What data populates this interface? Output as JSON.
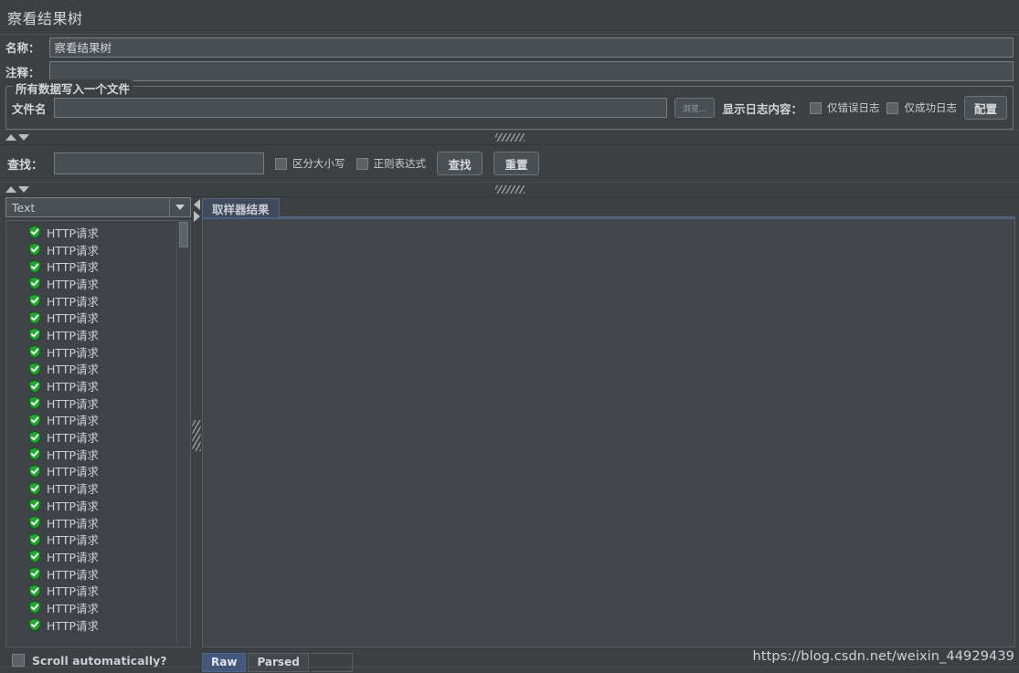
{
  "window": {
    "title": "察看结果树"
  },
  "name_row": {
    "label": "名称：",
    "value": "察看结果树"
  },
  "comment_row": {
    "label": "注释：",
    "value": "",
    "placeholder": ""
  },
  "file_group": {
    "title": "所有数据写入一个文件",
    "filename_label": "文件名",
    "filename_value": "",
    "browse_label": "浏览...",
    "log_display_label": "显示日志内容：",
    "errors_only_label": "仅错误日志",
    "errors_only_checked": false,
    "successes_only_label": "仅成功日志",
    "successes_only_checked": false,
    "configure_label": "配置"
  },
  "search_row": {
    "label": "查找：",
    "value": "",
    "case_sensitive_label": "区分大小写",
    "case_sensitive_checked": false,
    "regexp_label": "正则表达式",
    "regexp_checked": false,
    "search_button_label": "查找",
    "reset_button_label": "重置"
  },
  "left_pane": {
    "renderer_selected": "Text",
    "tree_items": [
      {
        "label": "HTTP请求",
        "status": "success"
      },
      {
        "label": "HTTP请求",
        "status": "success"
      },
      {
        "label": "HTTP请求",
        "status": "success"
      },
      {
        "label": "HTTP请求",
        "status": "success"
      },
      {
        "label": "HTTP请求",
        "status": "success"
      },
      {
        "label": "HTTP请求",
        "status": "success"
      },
      {
        "label": "HTTP请求",
        "status": "success"
      },
      {
        "label": "HTTP请求",
        "status": "success"
      },
      {
        "label": "HTTP请求",
        "status": "success"
      },
      {
        "label": "HTTP请求",
        "status": "success"
      },
      {
        "label": "HTTP请求",
        "status": "success"
      },
      {
        "label": "HTTP请求",
        "status": "success"
      },
      {
        "label": "HTTP请求",
        "status": "success"
      },
      {
        "label": "HTTP请求",
        "status": "success"
      },
      {
        "label": "HTTP请求",
        "status": "success"
      },
      {
        "label": "HTTP请求",
        "status": "success"
      },
      {
        "label": "HTTP请求",
        "status": "success"
      },
      {
        "label": "HTTP请求",
        "status": "success"
      },
      {
        "label": "HTTP请求",
        "status": "success"
      },
      {
        "label": "HTTP请求",
        "status": "success"
      },
      {
        "label": "HTTP请求",
        "status": "success"
      },
      {
        "label": "HTTP请求",
        "status": "success"
      },
      {
        "label": "HTTP请求",
        "status": "success"
      },
      {
        "label": "HTTP请求",
        "status": "success"
      }
    ],
    "scroll_auto_label": "Scroll automatically?",
    "scroll_auto_checked": false
  },
  "right_pane": {
    "tabs": [
      {
        "label": "取样器结果",
        "selected": true
      }
    ],
    "content": "",
    "bottom_tabs": [
      {
        "label": "Raw",
        "selected": true
      },
      {
        "label": "Parsed",
        "selected": false
      }
    ]
  },
  "watermark": {
    "text": "https://blog.csdn.net/weixin_44929439"
  },
  "colors": {
    "background": "#3c4043",
    "field": "#494e52",
    "accent_tab": "#3e4a5e",
    "accent_selected": "#42587d",
    "status_success": "#1faa2f",
    "text": "#c8cbce"
  }
}
